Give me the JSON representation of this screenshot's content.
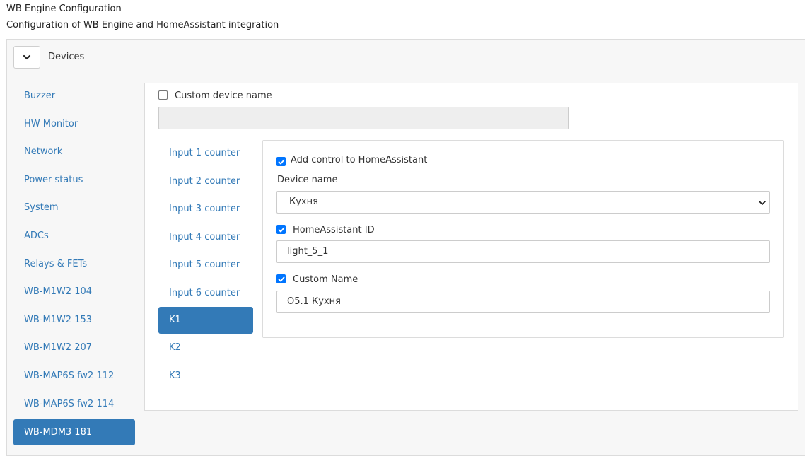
{
  "header": {
    "title": "WB Engine Configuration",
    "subtitle": "Configuration of WB Engine and HomeAssistant integration"
  },
  "section": {
    "label": "Devices",
    "toggle_icon": "chevron-down-icon"
  },
  "devices": {
    "items": [
      "Buzzer",
      "HW Monitor",
      "Network",
      "Power status",
      "System",
      "ADCs",
      "Relays & FETs",
      "WB-M1W2 104",
      "WB-M1W2 153",
      "WB-M1W2 207",
      "WB-MAP6S fw2 112",
      "WB-MAP6S fw2 114",
      "WB-MDM3 181"
    ],
    "active": "WB-MDM3 181"
  },
  "device_form": {
    "custom_device_name_label": "Custom device name",
    "custom_device_name_checked": false,
    "custom_device_name_value": ""
  },
  "channels": {
    "items": [
      "Input 1 counter",
      "Input 2 counter",
      "Input 3 counter",
      "Input 4 counter",
      "Input 5 counter",
      "Input 6 counter",
      "K1",
      "K2",
      "K3"
    ],
    "active": "K1"
  },
  "control_form": {
    "add_control_label": "Add control to HomeAssistant",
    "add_control_checked": true,
    "device_name_label": "Device name",
    "device_name_value": "Кухня",
    "ha_id_label": "HomeAssistant ID",
    "ha_id_checked": true,
    "ha_id_value": "light_5_1",
    "custom_name_label": "Custom Name",
    "custom_name_checked": true,
    "custom_name_value": "O5.1 Кухня"
  },
  "colors": {
    "accent": "#337ab7",
    "checkbox": "#0075ff"
  }
}
